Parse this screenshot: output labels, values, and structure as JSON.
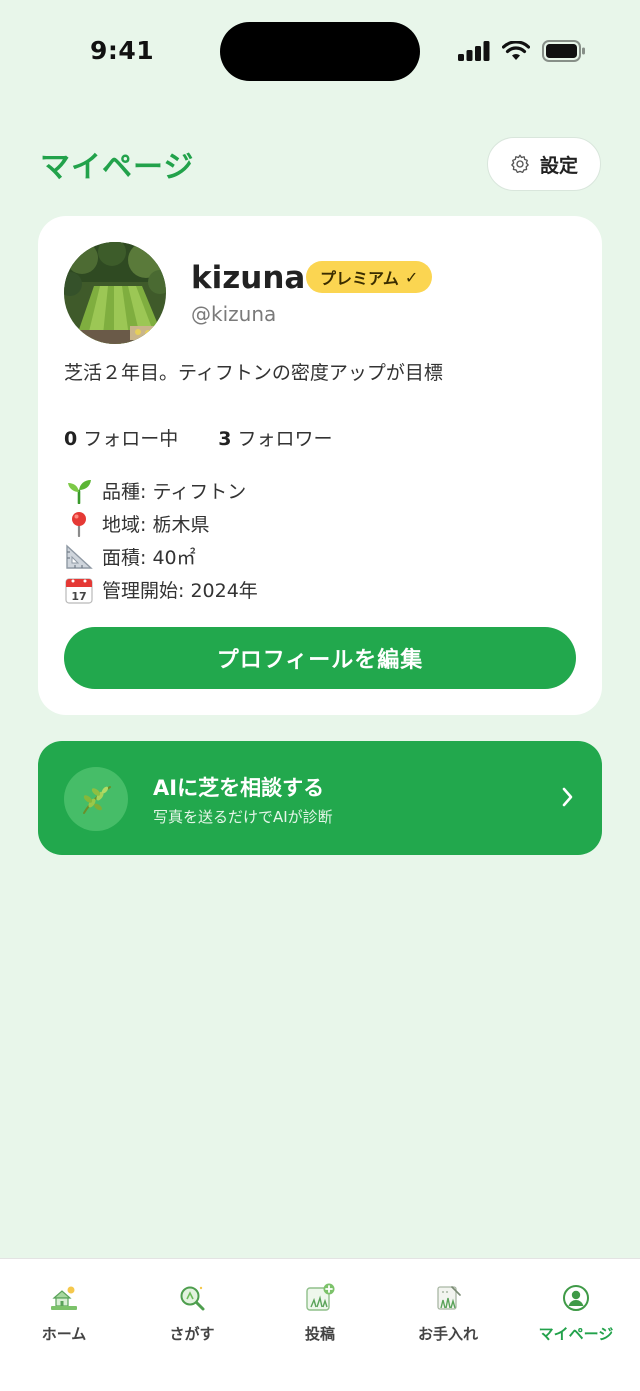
{
  "status_bar": {
    "time": "9:41"
  },
  "header": {
    "title": "マイページ",
    "settings_label": "設定"
  },
  "profile": {
    "username": "kizuna",
    "badge": "プレミアム",
    "badge_check": "✓",
    "handle": "@kizuna",
    "bio": "芝活２年目。ティフトンの密度アップが目標",
    "following_count": "0",
    "following_label": "フォロー中",
    "followers_count": "3",
    "followers_label": "フォロワー",
    "details": [
      {
        "icon": "seedling-icon",
        "text": "品種: ティフトン"
      },
      {
        "icon": "pin-icon",
        "text": "地域: 栃木県"
      },
      {
        "icon": "triangle-ruler-icon",
        "text": "面積: 40㎡"
      },
      {
        "icon": "calendar-icon",
        "text": "管理開始: 2024年",
        "calendar_day": "17"
      }
    ],
    "edit_button": "プロフィールを編集"
  },
  "ai_consult": {
    "title": "AIに芝を相談する",
    "subtitle": "写真を送るだけでAIが診断"
  },
  "tabs": [
    {
      "label": "ホーム",
      "icon": "home-icon",
      "active": false
    },
    {
      "label": "さがす",
      "icon": "search-icon",
      "active": false
    },
    {
      "label": "投稿",
      "icon": "post-icon",
      "active": false
    },
    {
      "label": "お手入れ",
      "icon": "care-icon",
      "active": false
    },
    {
      "label": "マイページ",
      "icon": "mypage-icon",
      "active": true
    }
  ],
  "colors": {
    "background": "#e8f6ea",
    "accent": "#22a84d",
    "badge": "#fbd551"
  }
}
